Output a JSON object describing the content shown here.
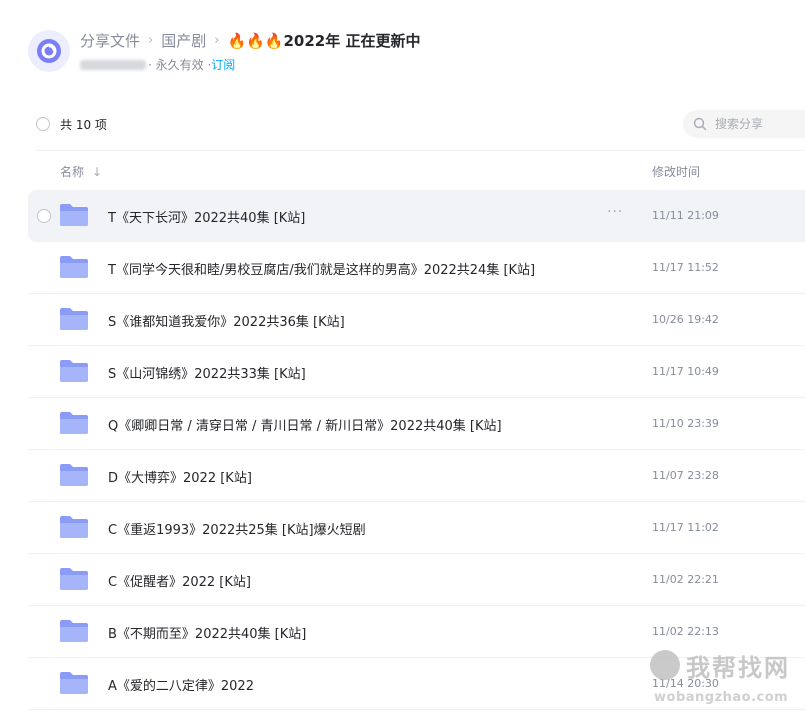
{
  "breadcrumb": {
    "items": [
      "分享文件",
      "国产剧"
    ],
    "current": "🔥🔥🔥2022年 正在更新中"
  },
  "meta": {
    "validity": "· 永久有效 ·",
    "subscribe": "订阅"
  },
  "toolbar": {
    "count_label": "共 10 项",
    "search_placeholder": "搜索分享"
  },
  "columns": {
    "name": "名称",
    "sort_arrow": "↓",
    "modified": "修改时间"
  },
  "files": [
    {
      "name": "T《天下长河》2022共40集 [K站]",
      "time": "11/11 21:09"
    },
    {
      "name": "T《同学今天很和睦/男校豆腐店/我们就是这样的男高》2022共24集 [K站]",
      "time": "11/17 11:52"
    },
    {
      "name": "S《谁都知道我爱你》2022共36集 [K站]",
      "time": "10/26 19:42"
    },
    {
      "name": "S《山河锦绣》2022共33集 [K站]",
      "time": "11/17 10:49"
    },
    {
      "name": "Q《卿卿日常 / 清穿日常 / 青川日常 / 新川日常》2022共40集 [K站]",
      "time": "11/10 23:39"
    },
    {
      "name": "D《大博弈》2022 [K站]",
      "time": "11/07 23:28"
    },
    {
      "name": "C《重返1993》2022共25集 [K站]爆火短剧",
      "time": "11/17 11:02"
    },
    {
      "name": "C《促醒者》2022 [K站]",
      "time": "11/02 22:21"
    },
    {
      "name": "B《不期而至》2022共40集 [K站]",
      "time": "11/02 22:13"
    },
    {
      "name": "A《爱的二八定律》2022",
      "time": "11/14 20:30"
    }
  ],
  "more_glyph": "···",
  "watermark": {
    "title": "我帮找网",
    "url": "wobangzhao.com"
  },
  "colors": {
    "accent": "#06a7ff",
    "folder": "#8a9cf6",
    "hover_row": "#f2f3f6"
  },
  "icons": [
    "cloud-logo-icon",
    "search-icon",
    "folder-icon",
    "more-icon"
  ]
}
